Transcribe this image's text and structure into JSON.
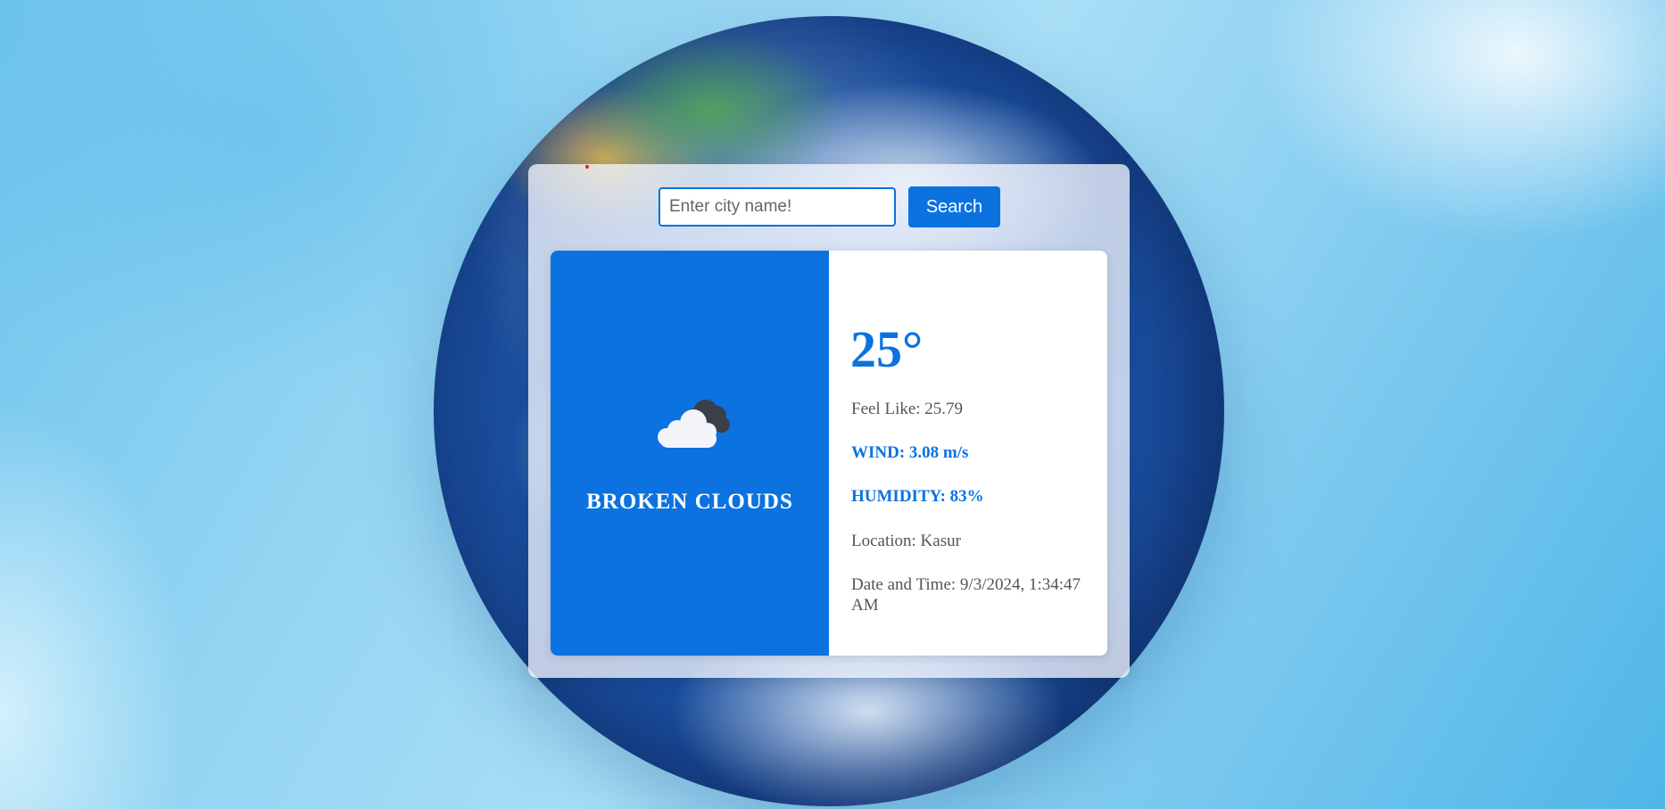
{
  "search": {
    "placeholder": "Enter city name!",
    "value": "",
    "button_label": "Search"
  },
  "weather": {
    "icon": "broken-clouds-icon",
    "condition": "BROKEN CLOUDS",
    "temperature": "25°",
    "feels_like": "Feel Like: 25.79",
    "wind": "WIND: 3.08 m/s",
    "humidity": "HUMIDITY: 83%",
    "location": "Location: Kasur",
    "datetime": "Date and Time: 9/3/2024, 1:34:47 AM"
  },
  "colors": {
    "accent": "#0b72e0",
    "panel": "#f0f4fc",
    "text": "#555555"
  }
}
